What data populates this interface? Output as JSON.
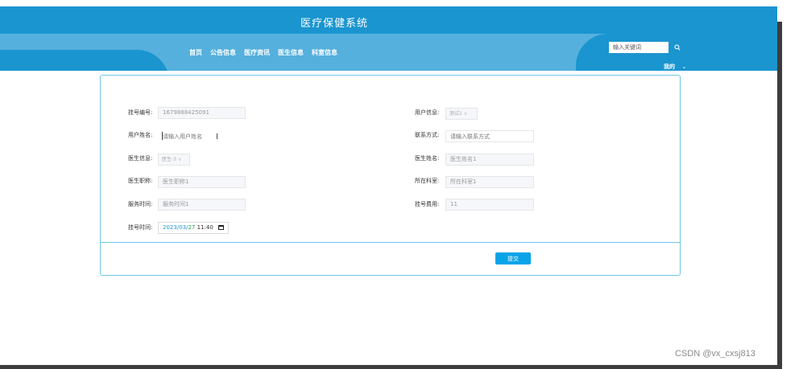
{
  "header": {
    "title": "医疗保健系统",
    "nav": [
      "首页",
      "公告信息",
      "医疗资讯",
      "医生信息",
      "科室信息"
    ],
    "search": {
      "placeholder": "输入关键词"
    },
    "user_menu": "我的",
    "user_menu_arrow": "⌄"
  },
  "form": {
    "fields": {
      "registration_no": {
        "label": "挂号编号:",
        "value": "1679888425091"
      },
      "user_info": {
        "label": "用户信息:",
        "value": "测试1"
      },
      "user_name": {
        "label": "用户姓名:",
        "placeholder": "请输入用户姓名"
      },
      "contact": {
        "label": "联系方式:",
        "placeholder": "请输入联系方式"
      },
      "doctor_info": {
        "label": "医生信息:",
        "value": "医生-3"
      },
      "doctor_name": {
        "label": "医生姓名:",
        "value": "医生姓名1"
      },
      "doctor_title": {
        "label": "医生职称:",
        "value": "医生职称1"
      },
      "department": {
        "label": "所在科室:",
        "value": "所在科室1"
      },
      "service_time": {
        "label": "服务时间:",
        "value": "服务时间1"
      },
      "fee": {
        "label": "挂号费用:",
        "value": "11"
      },
      "reg_time": {
        "label": "挂号时间:",
        "year": "2023",
        "sep1": "/",
        "month": "03",
        "sep2": "/",
        "day": "27",
        "time": " 11:40"
      }
    },
    "submit_label": "提交"
  },
  "cursor_text": "I",
  "watermark": "CSDN @vx_cxsj813",
  "colors": {
    "primary": "#1a95cf",
    "button": "#09a3e8",
    "border": "#6fc6e8"
  }
}
